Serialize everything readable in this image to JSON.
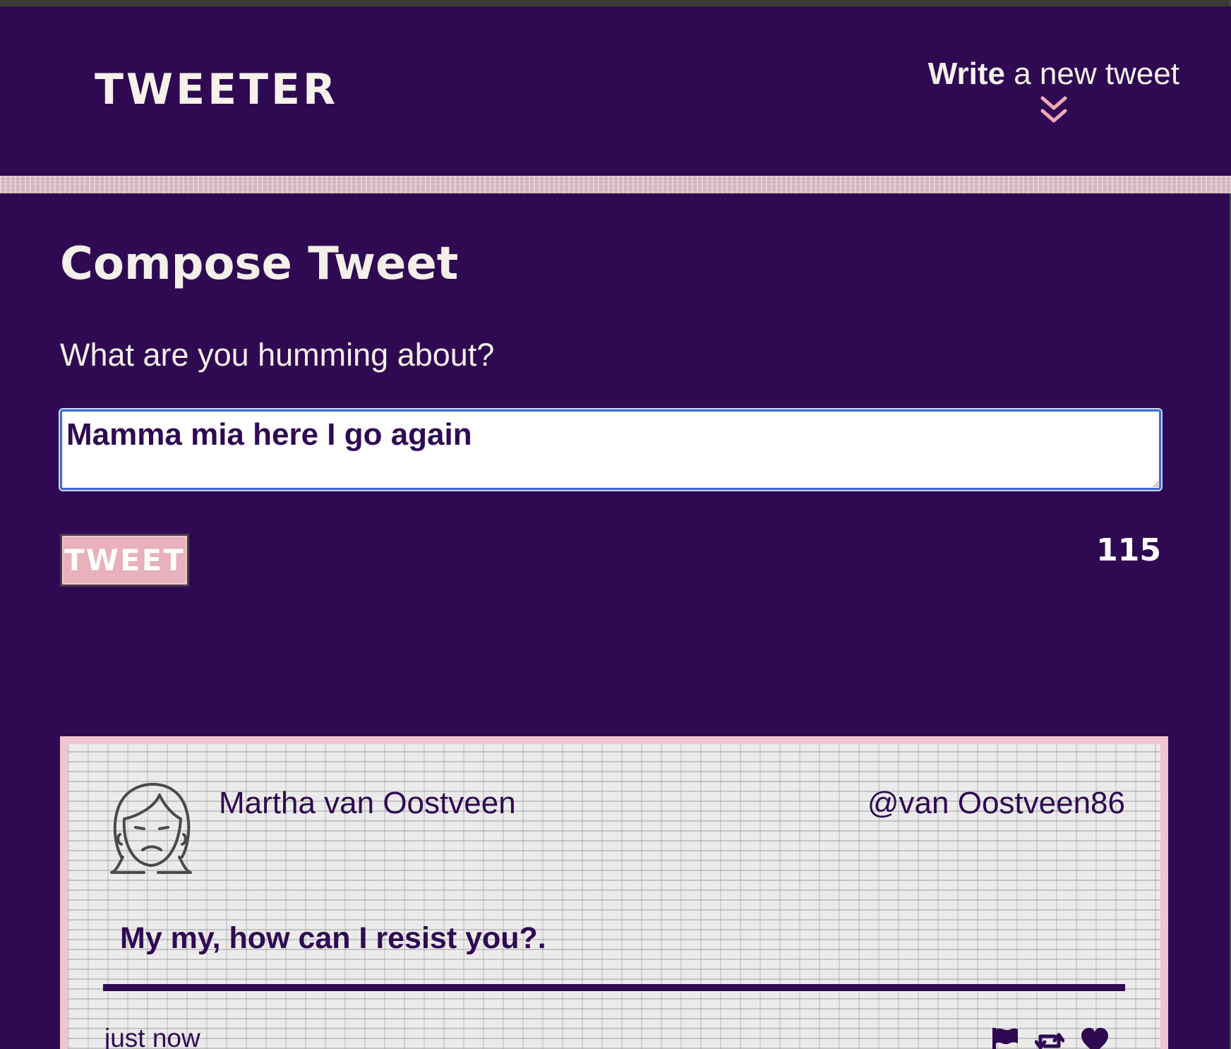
{
  "header": {
    "brand": "TWEETER",
    "compose_toggle_bold": "Write",
    "compose_toggle_rest": " a new tweet",
    "compose_toggle_icon": "double-chevron-down-icon"
  },
  "compose": {
    "title": "Compose Tweet",
    "prompt": "What are you humming about?",
    "input_value": "Mamma mia here I go again",
    "submit_label": "TWEET",
    "char_counter": "115"
  },
  "tweet": {
    "avatar_icon": "woman-face-avatar-icon",
    "author_name": "Martha van Oostveen",
    "author_handle": "@van Oostveen86",
    "text": "My my, how can I resist you?.",
    "timestamp": "just now",
    "actions": [
      "flag-icon",
      "retweet-icon",
      "heart-icon"
    ]
  },
  "colors": {
    "background": "#2f0a52",
    "accent_pink": "#f1c3cf",
    "button_pink": "#e8b1bb",
    "text_light": "#f4efe8",
    "input_focus_border": "#3b6bd6"
  }
}
